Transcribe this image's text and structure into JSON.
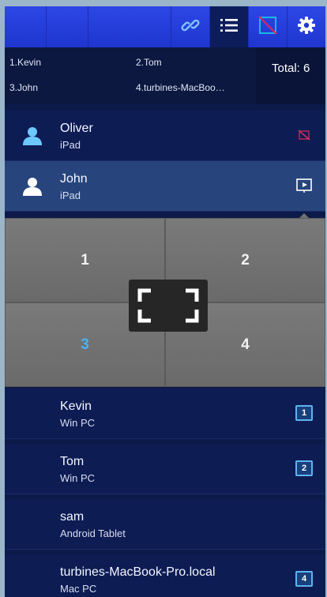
{
  "toolbar": {
    "buttons": [
      {
        "icon": "link-icon"
      },
      {
        "icon": "list-icon",
        "active": true
      },
      {
        "icon": "screen-off-icon"
      },
      {
        "icon": "gear-icon"
      }
    ]
  },
  "summary": {
    "participants": [
      "1.Kevin",
      "2.Tom",
      "3.John",
      "4.turbines-MacBoo…"
    ],
    "total": "Total: 6"
  },
  "users": [
    {
      "name": "Oliver",
      "device": "iPad",
      "icon": "presentation-off-icon"
    },
    {
      "name": "John",
      "device": "iPad",
      "icon": "present-screen-icon",
      "selected": true
    },
    {
      "name": "Kevin",
      "device": "Win PC",
      "slot": "1"
    },
    {
      "name": "Tom",
      "device": "Win PC",
      "slot": "2"
    },
    {
      "name": "sam",
      "device": "Android Tablet"
    },
    {
      "name": "turbines-MacBook-Pro.local",
      "device": "Mac PC",
      "slot": "4"
    }
  ],
  "quadrants": [
    "1",
    "2",
    "3",
    "4"
  ],
  "colors": {
    "accent": "#2c47e6",
    "highlight": "#44b3ff",
    "selected_row": "#27457c"
  }
}
